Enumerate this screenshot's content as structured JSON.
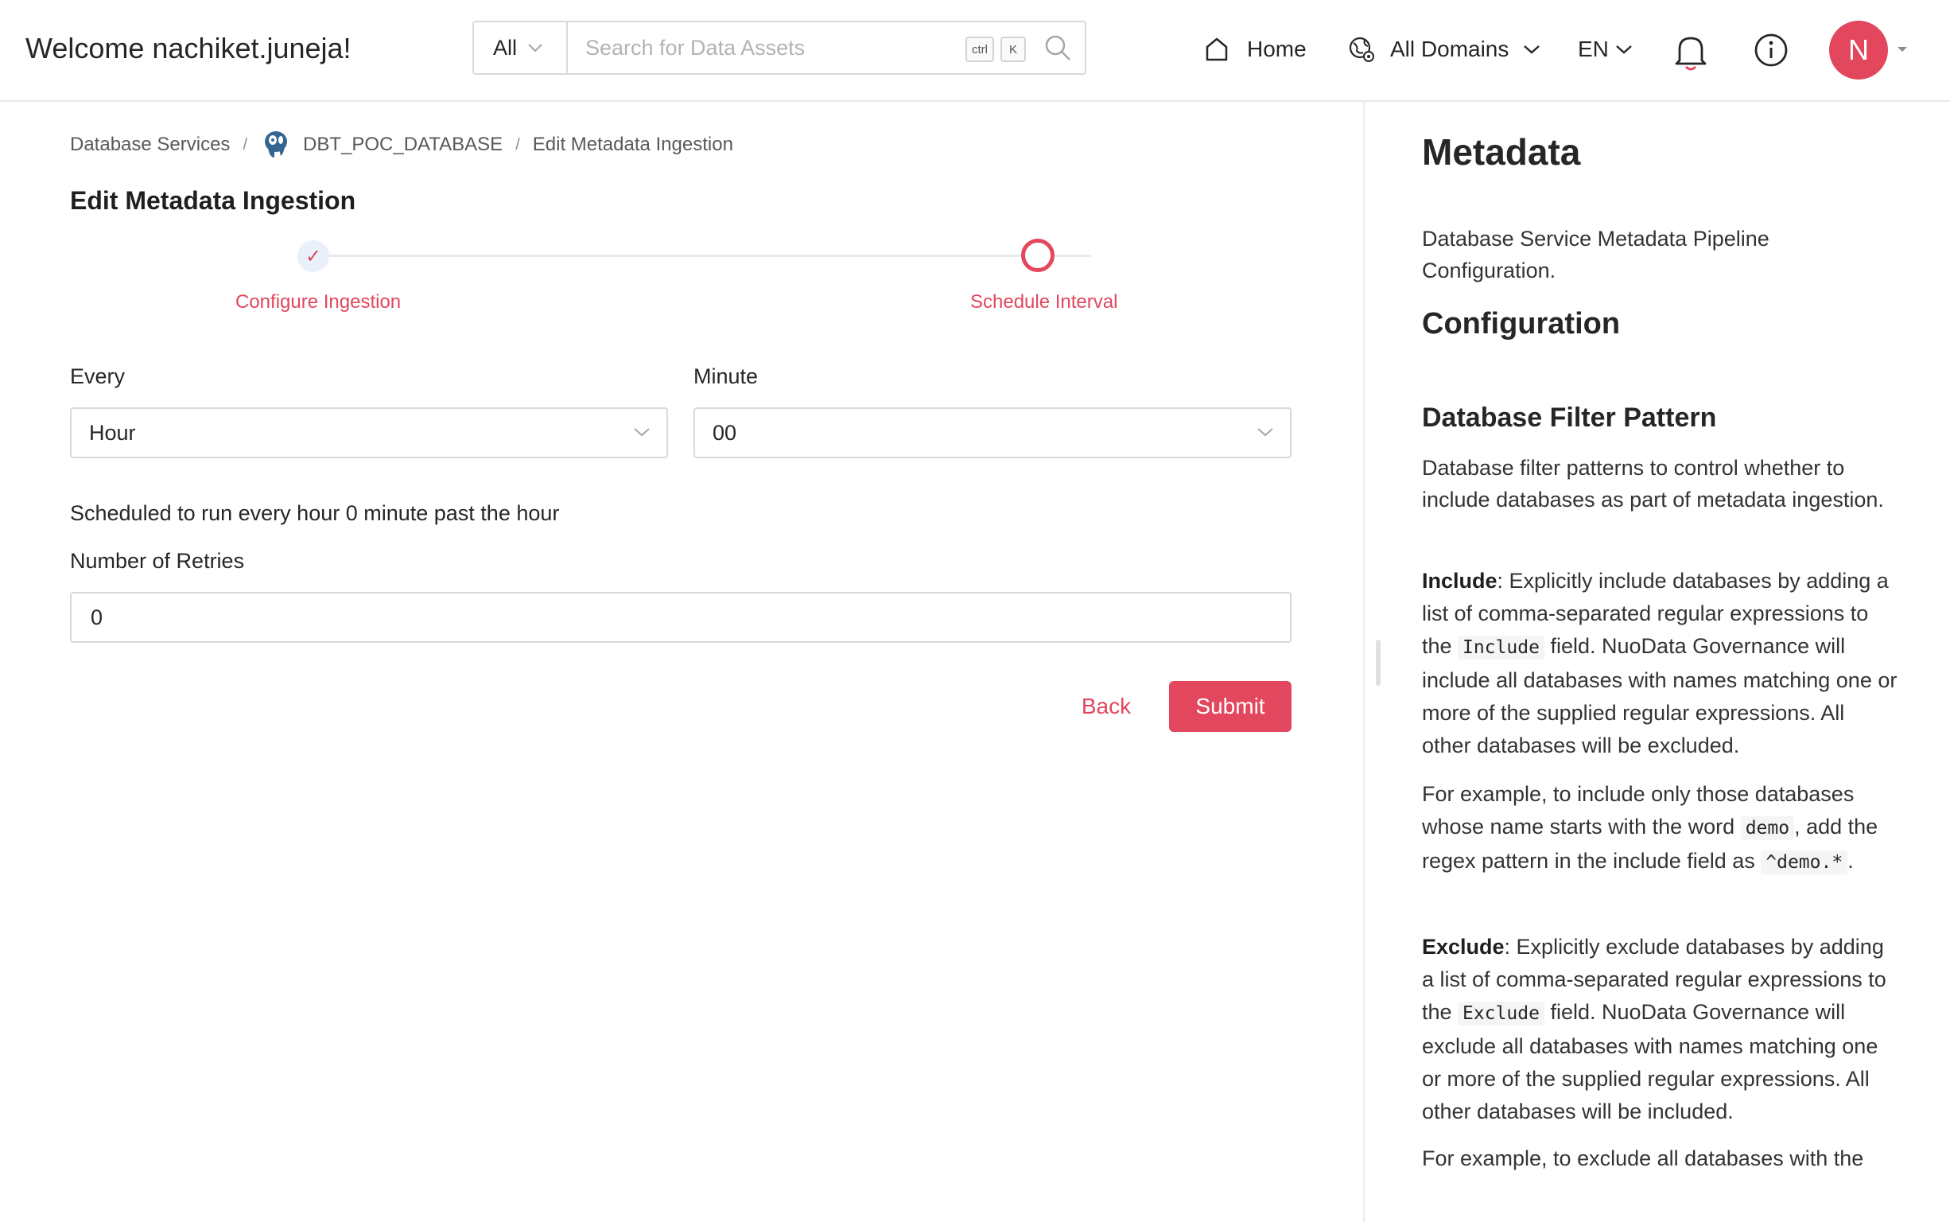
{
  "header": {
    "welcome": "Welcome nachiket.juneja!",
    "search": {
      "scope": "All",
      "placeholder": "Search for Data Assets",
      "shortcut_ctrl": "ctrl",
      "shortcut_key": "K"
    },
    "nav": {
      "home": "Home",
      "domains": "All Domains",
      "language": "EN"
    },
    "avatar_initial": "N"
  },
  "breadcrumb": {
    "items": [
      "Database Services",
      "DBT_POC_DATABASE",
      "Edit Metadata Ingestion"
    ],
    "separator": "/"
  },
  "page": {
    "title": "Edit Metadata Ingestion",
    "steps": [
      {
        "label": "Configure Ingestion",
        "state": "done"
      },
      {
        "label": "Schedule Interval",
        "state": "active"
      }
    ],
    "form": {
      "every_label": "Every",
      "every_value": "Hour",
      "minute_label": "Minute",
      "minute_value": "00",
      "schedule_text": "Scheduled to run every hour 0 minute past the hour",
      "retries_label": "Number of Retries",
      "retries_value": "0"
    },
    "buttons": {
      "back": "Back",
      "submit": "Submit"
    }
  },
  "doc": {
    "title": "Metadata",
    "intro": "Database Service Metadata Pipeline Configuration.",
    "config_heading": "Configuration",
    "filter_heading": "Database Filter Pattern",
    "filter_desc": "Database filter patterns to control whether to include databases as part of metadata ingestion.",
    "include_term": "Include",
    "include_p1": ": Explicitly include databases by adding a list of comma-separated regular expressions to the ",
    "include_code": "Include",
    "include_p2": " field. NuoData Governance will include all databases with names matching one or more of the supplied regular expressions. All other databases will be excluded.",
    "example1_p1": "For example, to include only those databases whose name starts with the word ",
    "example1_code1": "demo",
    "example1_p2": ", add the regex pattern in the include field as ",
    "example1_code2": "^demo.*",
    "example1_p3": ".",
    "exclude_term": "Exclude",
    "exclude_p1": ": Explicitly exclude databases by adding a list of comma-separated regular expressions to the ",
    "exclude_code": "Exclude",
    "exclude_p2": " field. NuoData Governance will exclude all databases with names matching one or more of the supplied regular expressions. All other databases will be included.",
    "example2": "For example, to exclude all databases with the"
  },
  "colors": {
    "accent": "#e2475d",
    "border": "#d9d9d9",
    "text": "#262626"
  },
  "icons": {
    "home": "home-icon",
    "domains": "domains-icon",
    "notifications": "bell-icon",
    "info": "info-icon",
    "database": "postgres-icon",
    "search": "search-icon"
  }
}
